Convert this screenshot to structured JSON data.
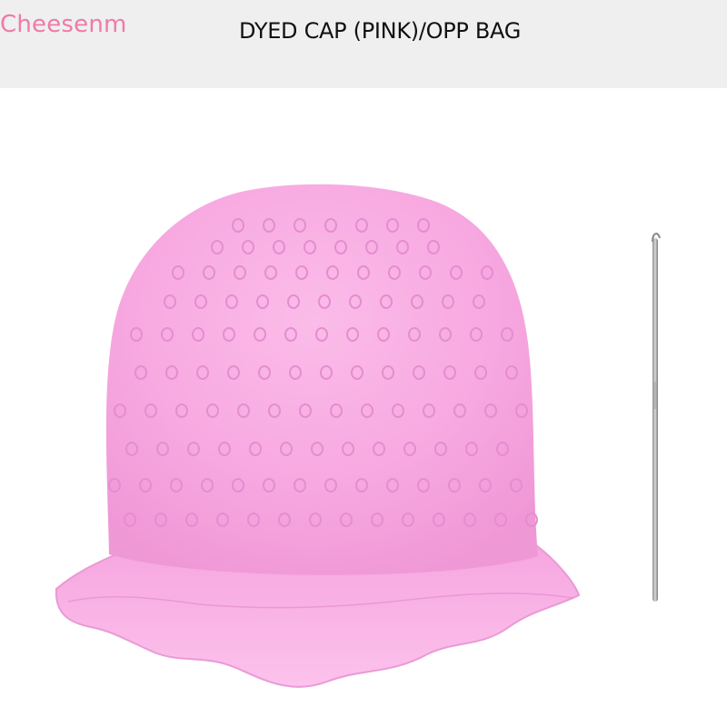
{
  "header": {
    "brand": "Cheesenm",
    "title": "DYED CAP (PINK)/OPP BAG"
  },
  "product": {
    "items": [
      "silicone-dye-cap",
      "crochet-hook"
    ],
    "cap_color": "#f7a8e0",
    "hole_color": "#e58dd0",
    "header_bg": "#efefef",
    "brand_color": "#ef7aa8"
  }
}
